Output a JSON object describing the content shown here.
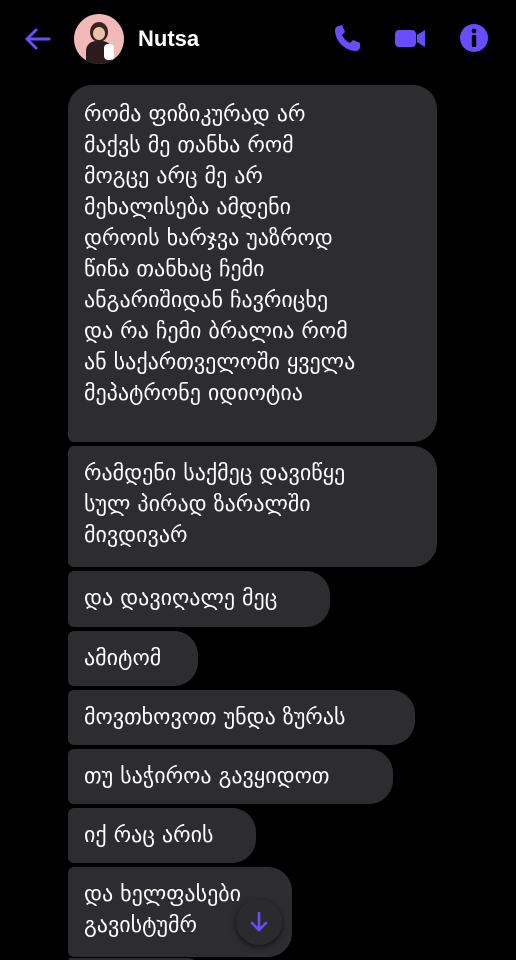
{
  "header": {
    "contact_name": "Nutsa",
    "back_icon": "arrow-left-icon",
    "call_icon": "phone-icon",
    "video_icon": "video-camera-icon",
    "info_icon": "info-icon",
    "accent_color": "#6a4cff"
  },
  "messages": [
    {
      "text": "რომა ფიზიკურად არ\nმაქვს მე თანხა რომ\nმოგცე არც მე არ\nმეხალისება ამდენი\nდროის ხარჯვა  უაზროდ\nწინა თანხაც ჩემი\nანგარიშიდან ჩავრიცხე\nდა რა ჩემი ბრალია რომ\nან საქართველოში ყველა\nმეპატრონე იდიოტია"
    },
    {
      "text": "რამდენი საქმეც დავიწყე\nსულ პირად ზარალში\nმივდივარ"
    },
    {
      "text": "და დავიღალე მეც"
    },
    {
      "text": "ამიტომ"
    },
    {
      "text": "მოვთხოვოთ უნდა ზურას"
    },
    {
      "text": "თუ საჭიროა გავყიდოთ"
    },
    {
      "text": "იქ რაც არის"
    },
    {
      "text": "და ხელფასები\nგავისტუმრ"
    }
  ],
  "scroll_button_icon": "arrow-down-icon"
}
